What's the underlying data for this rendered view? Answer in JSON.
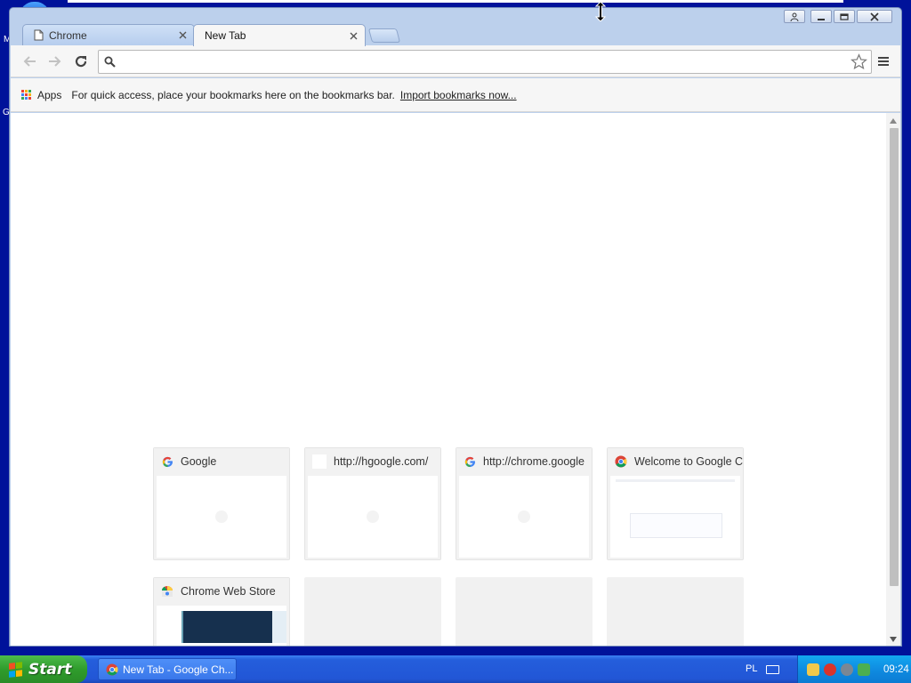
{
  "browser": {
    "tabs": [
      {
        "title": "Chrome",
        "active": false
      },
      {
        "title": "New Tab",
        "active": true
      }
    ],
    "omnibox": {
      "value": "",
      "placeholder": ""
    },
    "bookmarks_bar": {
      "apps_label": "Apps",
      "hint": "For quick access, place your bookmarks here on the bookmarks bar.",
      "import_link": "Import bookmarks now..."
    }
  },
  "most_visited": [
    {
      "title": "Google",
      "favicon": "google-g-icon"
    },
    {
      "title": "http://hgoogle.com/",
      "favicon": "blank-page-icon"
    },
    {
      "title": "http://chrome.google",
      "favicon": "google-g-icon"
    },
    {
      "title": "Welcome to Google C",
      "favicon": "chrome-icon"
    },
    {
      "title": "Chrome Web Store",
      "favicon": "web-store-icon"
    },
    {
      "title": "",
      "favicon": ""
    },
    {
      "title": "",
      "favicon": ""
    },
    {
      "title": "",
      "favicon": ""
    }
  ],
  "taskbar": {
    "start_label": "Start",
    "task_item": "New Tab - Google Ch...",
    "language": "PL",
    "clock": "09:24"
  },
  "desktop": {
    "left_letters": [
      "M",
      "G"
    ]
  },
  "colors": {
    "desktop_bg": "#00129a",
    "window_frame": "#bcd0ec",
    "taskbar": "#245edc",
    "start_green": "#2f9c2c"
  }
}
